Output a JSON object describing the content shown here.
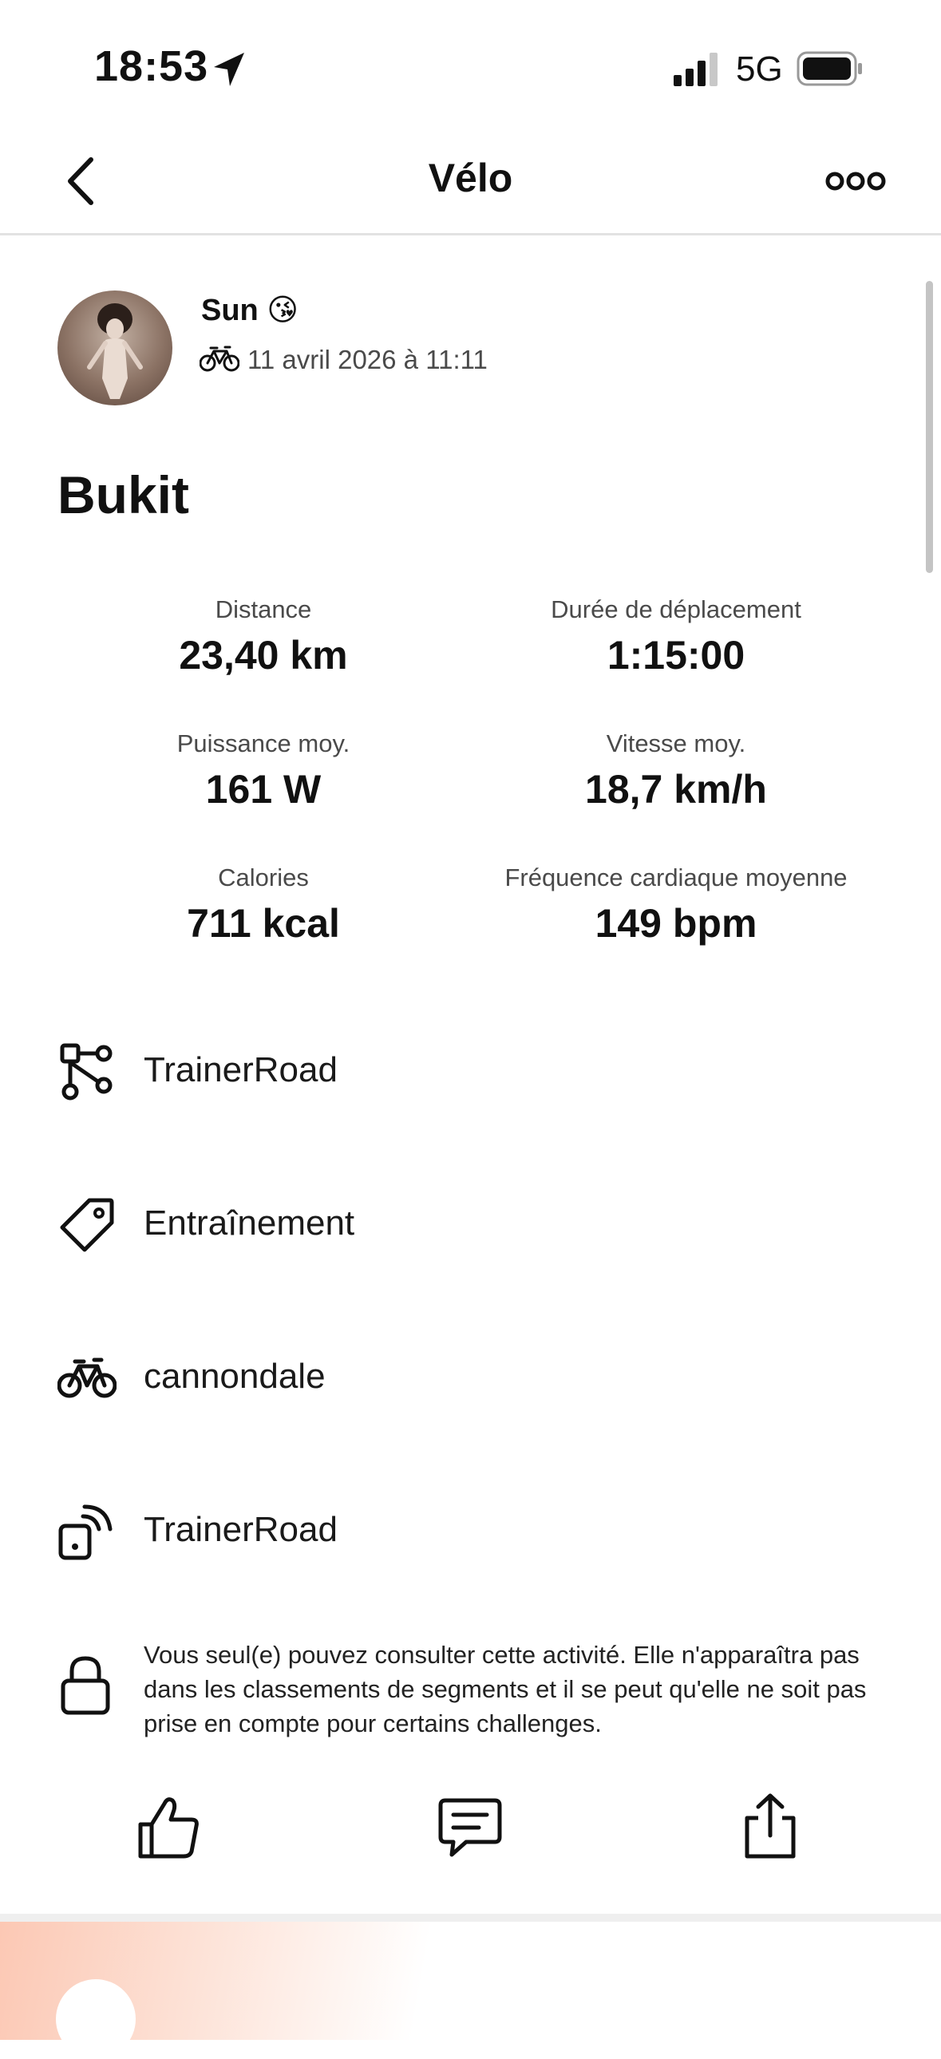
{
  "status_bar": {
    "time": "18:53",
    "network": "5G",
    "icons": [
      "location-arrow-icon",
      "signal-icon",
      "battery-icon"
    ]
  },
  "nav": {
    "title": "Vélo",
    "icons": [
      "back-chevron-icon",
      "more-icon"
    ]
  },
  "activity": {
    "athlete_name": "Sun 😘",
    "date": "11 avril 2026 à 11:11",
    "title": "Bukit"
  },
  "stats": [
    {
      "label": "Distance",
      "value": "23,40 km"
    },
    {
      "label": "Durée de déplacement",
      "value": "1:15:00"
    },
    {
      "label": "Puissance moy.",
      "value": "161 W"
    },
    {
      "label": "Vitesse moy.",
      "value": "18,7 km/h"
    },
    {
      "label": "Calories",
      "value": "711 kcal"
    },
    {
      "label": "Fréquence cardiaque moyenne",
      "value": "149 bpm"
    }
  ],
  "details": [
    {
      "icon": "workout-tree-icon",
      "text": "TrainerRoad"
    },
    {
      "icon": "tag-icon",
      "text": "Entraînement"
    },
    {
      "icon": "bike-icon",
      "text": "cannondale"
    },
    {
      "icon": "device-sensor-icon",
      "text": "TrainerRoad"
    }
  ],
  "privacy": {
    "icon": "lock-icon",
    "text": "Vous seul(e) pouvez consulter cette activité. Elle n'apparaîtra pas dans les classements de segments et il se peut qu'elle ne soit pas prise en compte pour certains challenges."
  },
  "actions": [
    "kudos-thumb-icon",
    "comment-icon",
    "share-icon"
  ],
  "colors": {
    "text": "#111111",
    "secondary_text": "#4a4a4a",
    "divider": "#e2e2e2",
    "bottom_gradient": "#fcc8b4"
  }
}
